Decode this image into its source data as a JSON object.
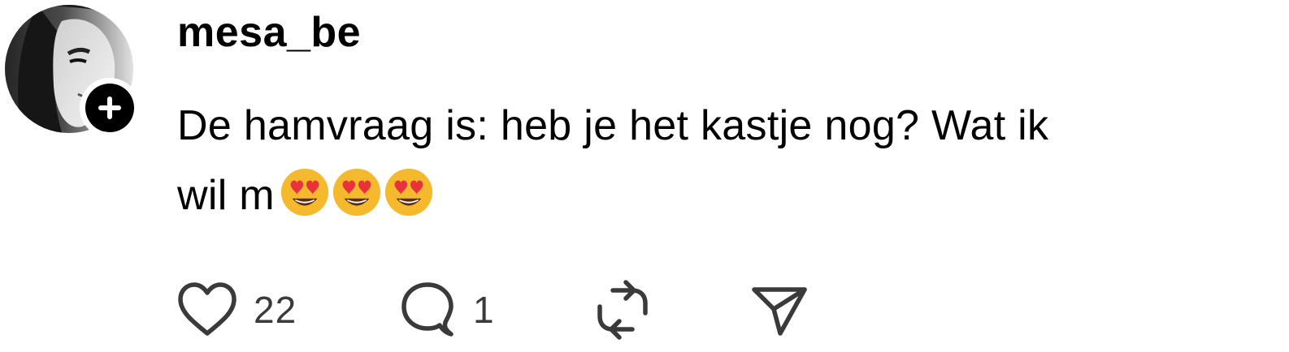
{
  "post": {
    "username": "mesa_be",
    "text_line1": "De hamvraag is: heb je het kastje nog? Wat ik",
    "text_line2": "wil m",
    "emojis": [
      "smiling-face-with-heart-eyes",
      "smiling-face-with-heart-eyes",
      "smiling-face-with-heart-eyes"
    ]
  },
  "actions": {
    "likes_count": "22",
    "replies_count": "1",
    "icons": [
      "heart-icon",
      "comment-icon",
      "repost-icon",
      "share-icon"
    ]
  },
  "colors": {
    "text": "#000000",
    "count_text": "#3a3a3a",
    "icon_stroke": "#3a3a3a",
    "badge": "#000000",
    "emoji_face": "#f5b92e",
    "emoji_heart": "#e8323c"
  }
}
